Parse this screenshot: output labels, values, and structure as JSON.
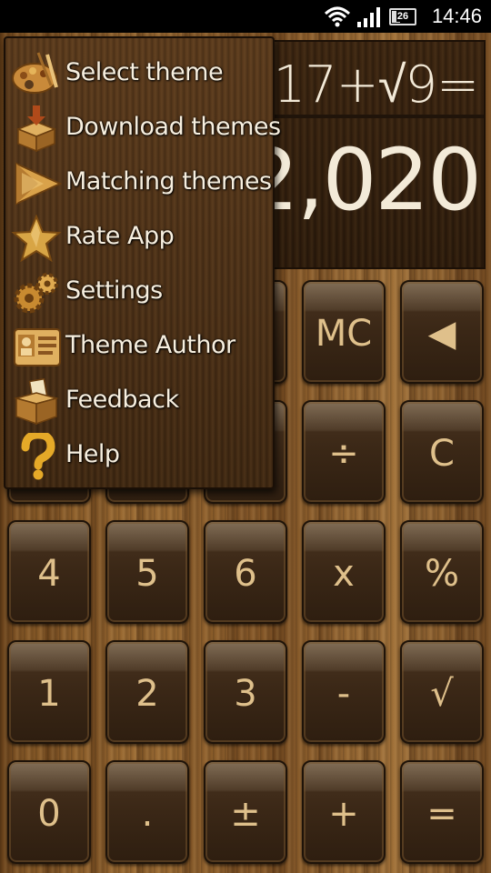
{
  "status_bar": {
    "time": "14:46",
    "battery_level": "26",
    "icons": [
      "wifi-icon",
      "signal-icon",
      "battery-icon"
    ]
  },
  "display": {
    "expression": "017+√9=",
    "result": "2,020"
  },
  "keypad": {
    "row1": [
      "MC",
      "◀"
    ],
    "row2": [
      "÷",
      "C"
    ],
    "row3": [
      "4",
      "5",
      "6",
      "x",
      "%"
    ],
    "row4": [
      "1",
      "2",
      "3",
      "-",
      "√"
    ],
    "row5": [
      "0",
      ".",
      "±",
      "+",
      "="
    ]
  },
  "menu": {
    "items": [
      {
        "label": "Select theme",
        "icon": "palette-icon"
      },
      {
        "label": "Download themes",
        "icon": "download-box-icon"
      },
      {
        "label": "Matching themes",
        "icon": "play-store-icon"
      },
      {
        "label": "Rate App",
        "icon": "star-icon"
      },
      {
        "label": "Settings",
        "icon": "gears-icon"
      },
      {
        "label": "Theme Author",
        "icon": "id-card-icon"
      },
      {
        "label": "Feedback",
        "icon": "ballot-box-icon"
      },
      {
        "label": "Help",
        "icon": "question-mark-icon"
      }
    ]
  },
  "colors": {
    "key_text": "#dfc08b",
    "display_text": "#f3ead8",
    "menu_text": "#f7efdf",
    "icon_gold": "#d8a545"
  }
}
